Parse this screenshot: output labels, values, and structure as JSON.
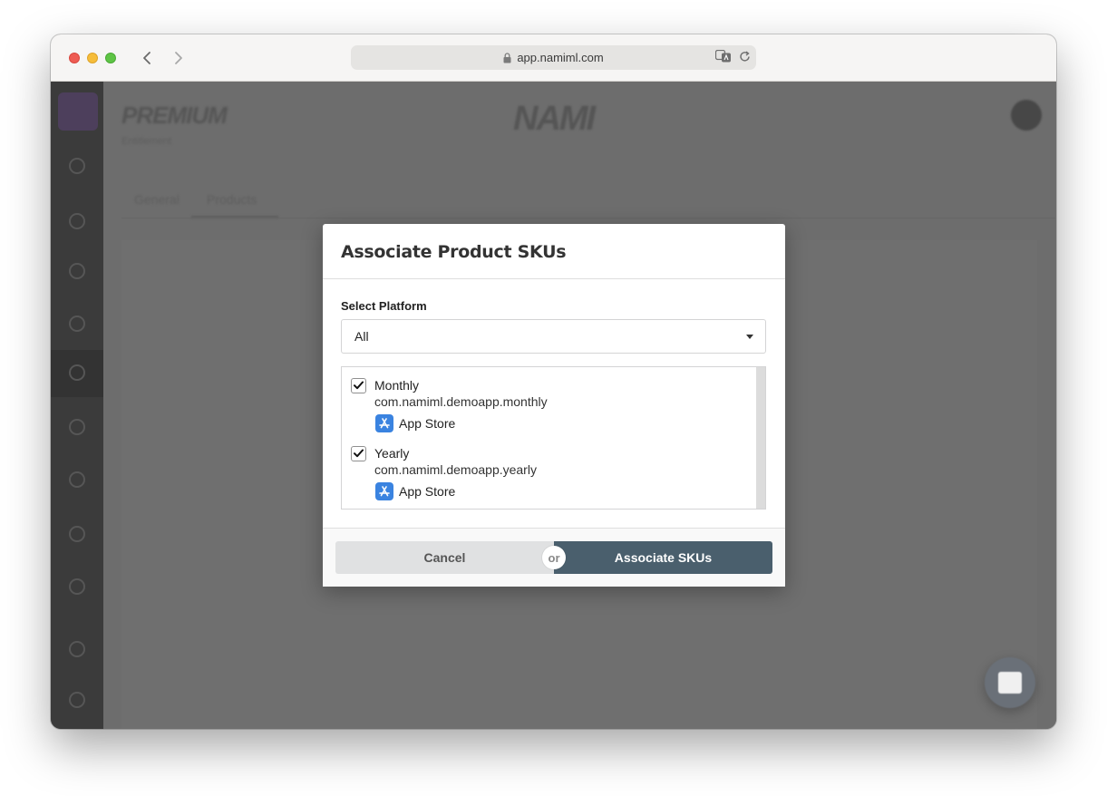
{
  "browser": {
    "url": "app.namiml.com"
  },
  "background": {
    "brand_title": "PREMIUM",
    "brand_subtitle": "Entitlement",
    "logo_text": "NAMI",
    "tabs": [
      "General",
      "Products"
    ]
  },
  "modal": {
    "title": "Associate Product SKUs",
    "platform_label": "Select Platform",
    "platform_value": "All",
    "skus": [
      {
        "name": "Monthly",
        "sku_id": "com.namiml.demoapp.monthly",
        "store": "App Store",
        "checked": true
      },
      {
        "name": "Yearly",
        "sku_id": "com.namiml.demoapp.yearly",
        "store": "App Store",
        "checked": true
      }
    ],
    "cancel_label": "Cancel",
    "or_label": "or",
    "associate_label": "Associate SKUs"
  },
  "colors": {
    "primary_button": "#4a5f6d",
    "app_store_icon": "#3a83e0"
  }
}
